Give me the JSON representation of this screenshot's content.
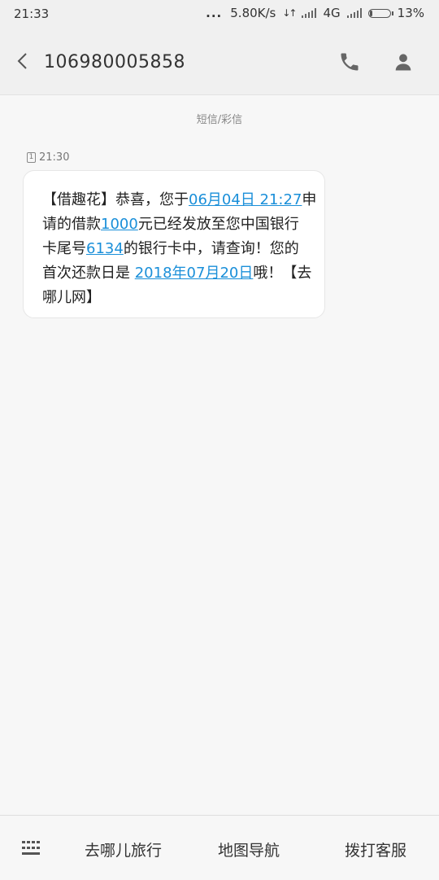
{
  "status_bar": {
    "time": "21:33",
    "dots": "...",
    "network_speed": "5.80K/s",
    "network_type": "4G",
    "battery_percent": "13%",
    "battery_level": 0.13,
    "icons": [
      "data-arrows-icon",
      "signal-icon",
      "signal-icon",
      "battery-icon"
    ]
  },
  "header": {
    "contact": "106980005858",
    "icons": [
      "back-chevron-icon",
      "phone-icon",
      "contact-person-icon"
    ]
  },
  "conversation": {
    "channel_label": "短信/彩信",
    "message": {
      "sim_slot": "1",
      "time": "21:30",
      "lines": [
        [
          {
            "text": "【借趣花】恭喜，您于",
            "link": false
          },
          {
            "text": "06月04日 21:27",
            "link": true
          },
          {
            "text": "申",
            "link": false
          }
        ],
        [
          {
            "text": "请的借款",
            "link": false
          },
          {
            "text": "1000",
            "link": true
          },
          {
            "text": "元已经发放至您中国银行",
            "link": false
          }
        ],
        [
          {
            "text": "卡尾号",
            "link": false
          },
          {
            "text": "6134",
            "link": true
          },
          {
            "text": "的银行卡中，请查询！您的",
            "link": false
          }
        ],
        [
          {
            "text": "首次还款日是 ",
            "link": false
          },
          {
            "text": "2018年07月20日",
            "link": true
          },
          {
            "text": "哦！【去",
            "link": false
          }
        ],
        [
          {
            "text": "哪儿网】",
            "link": false
          }
        ]
      ]
    }
  },
  "bottom_bar": {
    "icon": "keyboard-grid-icon",
    "actions": [
      "去哪儿旅行",
      "地图导航",
      "拨打客服"
    ]
  },
  "colors": {
    "link": "#1a8fd9",
    "background": "#f7f7f7",
    "header": "#f0f0f0",
    "bubble": "#ffffff"
  }
}
